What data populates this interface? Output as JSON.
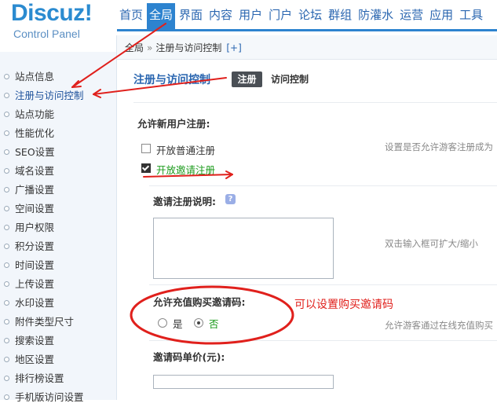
{
  "header": {
    "logo": "Discuz!",
    "logo_sub": "Control Panel",
    "nav": [
      {
        "label": "首页",
        "active": false
      },
      {
        "label": "全局",
        "active": true
      },
      {
        "label": "界面",
        "active": false
      },
      {
        "label": "内容",
        "active": false
      },
      {
        "label": "用户",
        "active": false
      },
      {
        "label": "门户",
        "active": false
      },
      {
        "label": "论坛",
        "active": false
      },
      {
        "label": "群组",
        "active": false
      },
      {
        "label": "防灌水",
        "active": false
      },
      {
        "label": "运营",
        "active": false
      },
      {
        "label": "应用",
        "active": false
      },
      {
        "label": "工具",
        "active": false
      }
    ]
  },
  "breadcrumb": {
    "root": "全局",
    "separator": "»",
    "current": "注册与访问控制",
    "add": "[+]"
  },
  "sidebar": {
    "items": [
      {
        "label": "站点信息",
        "active": false
      },
      {
        "label": "注册与访问控制",
        "active": true
      },
      {
        "label": "站点功能",
        "active": false
      },
      {
        "label": "性能优化",
        "active": false
      },
      {
        "label": "SEO设置",
        "active": false
      },
      {
        "label": "域名设置",
        "active": false
      },
      {
        "label": "广播设置",
        "active": false
      },
      {
        "label": "空间设置",
        "active": false
      },
      {
        "label": "用户权限",
        "active": false
      },
      {
        "label": "积分设置",
        "active": false
      },
      {
        "label": "时间设置",
        "active": false
      },
      {
        "label": "上传设置",
        "active": false
      },
      {
        "label": "水印设置",
        "active": false
      },
      {
        "label": "附件类型尺寸",
        "active": false
      },
      {
        "label": "搜索设置",
        "active": false
      },
      {
        "label": "地区设置",
        "active": false
      },
      {
        "label": "排行榜设置",
        "active": false
      },
      {
        "label": "手机版访问设置",
        "active": false
      }
    ]
  },
  "main": {
    "title": "注册与访问控制",
    "tabs": [
      {
        "label": "注册",
        "active": true
      },
      {
        "label": "访问控制",
        "active": false
      }
    ],
    "allow_register": {
      "label": "允许新用户注册:",
      "options": [
        {
          "label": "开放普通注册",
          "checked": false
        },
        {
          "label": "开放邀请注册",
          "checked": true
        }
      ],
      "hint": "设置是否允许游客注册成为"
    },
    "invite_desc": {
      "label": "邀请注册说明:",
      "help_icon": "?",
      "value": "",
      "hint": "双击输入框可扩大/缩小"
    },
    "buy_invite": {
      "label": "允许充值购买邀请码:",
      "options": [
        {
          "label": "是",
          "checked": false
        },
        {
          "label": "否",
          "checked": true
        }
      ],
      "hint": "允许游客通过在线充值购买"
    },
    "invite_price": {
      "label": "邀请码单价(元):",
      "value": ""
    }
  },
  "annotation": {
    "text": "可以设置购买邀请码",
    "color": "#e0201c"
  },
  "colors": {
    "accent": "#2d83cf",
    "sidebar_bg": "#f2f6fb",
    "highlight_green": "#1a9a1a"
  }
}
